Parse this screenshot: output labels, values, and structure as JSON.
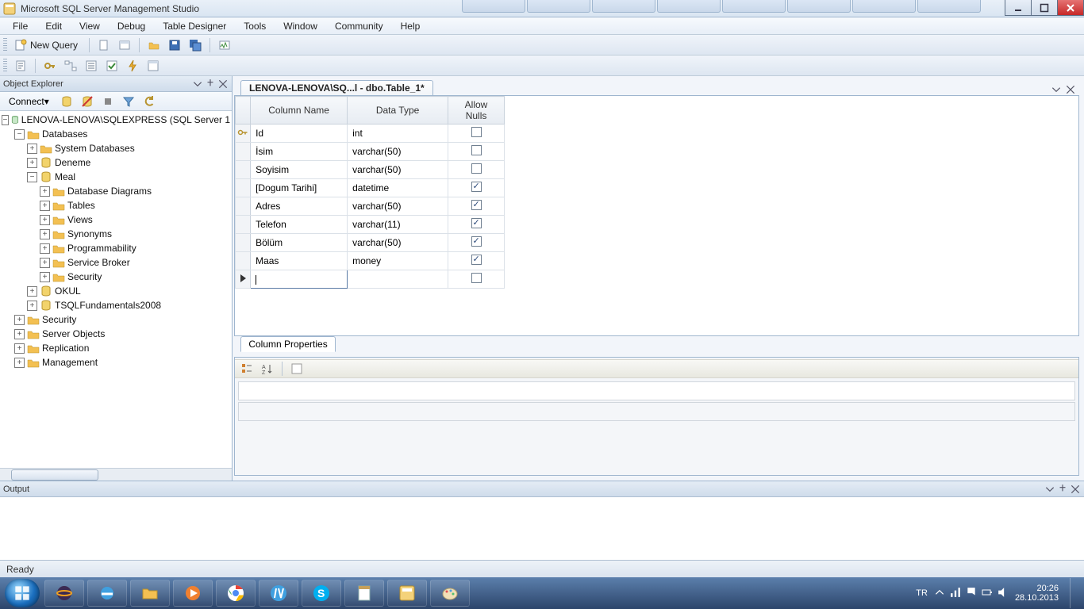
{
  "app": {
    "title": "Microsoft SQL Server Management Studio"
  },
  "menu": {
    "file": "File",
    "edit": "Edit",
    "view": "View",
    "debug": "Debug",
    "table_designer": "Table Designer",
    "tools": "Tools",
    "window": "Window",
    "community": "Community",
    "help": "Help"
  },
  "toolbar": {
    "new_query": "New Query"
  },
  "object_explorer": {
    "title": "Object Explorer",
    "connect": "Connect",
    "tree": {
      "server": "LENOVA-LENOVA\\SQLEXPRESS (SQL Server 1",
      "databases": "Databases",
      "system_databases": "System Databases",
      "deneme": "Deneme",
      "meal": "Meal",
      "db_diagrams": "Database Diagrams",
      "tables": "Tables",
      "views": "Views",
      "synonyms": "Synonyms",
      "programmability": "Programmability",
      "service_broker": "Service Broker",
      "security_inner": "Security",
      "okul": "OKUL",
      "tsql": "TSQLFundamentals2008",
      "security": "Security",
      "server_objects": "Server Objects",
      "replication": "Replication",
      "management": "Management"
    }
  },
  "document": {
    "tab_label": "LENOVA-LENOVA\\SQ...l - dbo.Table_1*"
  },
  "grid": {
    "headers": {
      "col": "Column Name",
      "type": "Data Type",
      "nulls": "Allow Nulls"
    },
    "rows": [
      {
        "pk": true,
        "name": "Id",
        "type": "int",
        "nulls": false
      },
      {
        "pk": false,
        "name": "İsim",
        "type": "varchar(50)",
        "nulls": false
      },
      {
        "pk": false,
        "name": "Soyisim",
        "type": "varchar(50)",
        "nulls": false
      },
      {
        "pk": false,
        "name": "[Dogum Tarihi]",
        "type": "datetime",
        "nulls": true
      },
      {
        "pk": false,
        "name": "Adres",
        "type": "varchar(50)",
        "nulls": true
      },
      {
        "pk": false,
        "name": "Telefon",
        "type": "varchar(11)",
        "nulls": true
      },
      {
        "pk": false,
        "name": "Bölüm",
        "type": "varchar(50)",
        "nulls": true
      },
      {
        "pk": false,
        "name": "Maas",
        "type": "money",
        "nulls": true
      }
    ]
  },
  "column_properties": {
    "title": "Column Properties"
  },
  "output": {
    "title": "Output"
  },
  "status": {
    "text": "Ready"
  },
  "system_tray": {
    "lang": "TR",
    "time": "20:26",
    "date": "28.10.2013"
  }
}
